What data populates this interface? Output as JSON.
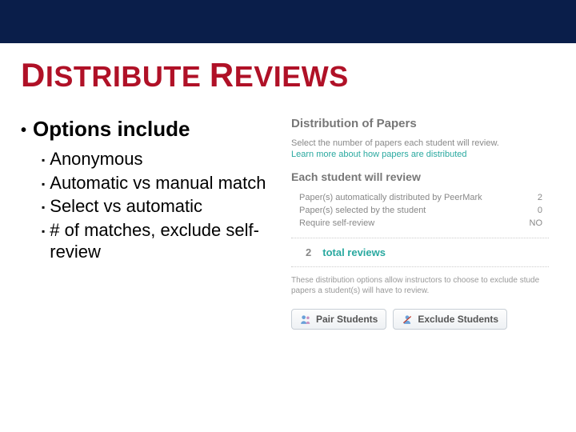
{
  "title_parts": {
    "d": "D",
    "istribute": "ISTRIBUTE",
    "space": " ",
    "r": "R",
    "eviews": "EVIEWS"
  },
  "options_heading": "Options include",
  "subitems": [
    "Anonymous",
    "Automatic vs manual match",
    "Select vs automatic",
    "# of matches, exclude self-review"
  ],
  "panel": {
    "title": "Distribution of Papers",
    "sub": "Select the number of papers each student will review.",
    "link": "Learn more about how papers are distributed",
    "section": "Each student will review",
    "rows": [
      {
        "label": "Paper(s) automatically distributed by PeerMark",
        "value": "2"
      },
      {
        "label": "Paper(s) selected by the student",
        "value": "0"
      },
      {
        "label": "Require self-review",
        "value": "NO"
      }
    ],
    "total_num": "2",
    "total_label": "total reviews",
    "footnote": "These distribution options allow instructors to choose to exclude stude papers a student(s) will have to review.",
    "buttons": {
      "pair": "Pair Students",
      "exclude": "Exclude Students"
    }
  }
}
